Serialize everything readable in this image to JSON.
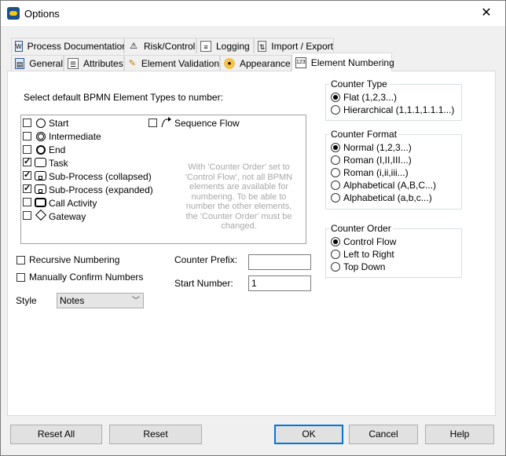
{
  "window": {
    "title": "Options",
    "close_glyph": "✕"
  },
  "tabs_row1": [
    {
      "label": "Process Documentation",
      "icon": "document-icon"
    },
    {
      "label": "Risk/Control",
      "icon": "warning-icon"
    },
    {
      "label": "Logging",
      "icon": "log-icon"
    },
    {
      "label": "Import / Export",
      "icon": "import-export-icon"
    }
  ],
  "tabs_row2": [
    {
      "label": "General",
      "icon": "general-icon"
    },
    {
      "label": "Attributes",
      "icon": "attributes-icon"
    },
    {
      "label": "Element Validation",
      "icon": "validation-icon"
    },
    {
      "label": "Appearance",
      "icon": "palette-icon"
    },
    {
      "label": "Element Numbering",
      "icon": "numbering-icon",
      "active": true
    }
  ],
  "element_types": {
    "heading": "Select default BPMN Element Types to number:",
    "items": [
      {
        "label": "Start",
        "checked": false
      },
      {
        "label": "Intermediate",
        "checked": false
      },
      {
        "label": "End",
        "checked": false
      },
      {
        "label": "Task",
        "checked": true
      },
      {
        "label": "Sub-Process (collapsed)",
        "checked": true
      },
      {
        "label": "Sub-Process (expanded)",
        "checked": true
      },
      {
        "label": "Call Activity",
        "checked": false
      },
      {
        "label": "Gateway",
        "checked": false
      },
      {
        "label": "Sequence Flow",
        "checked": false
      }
    ],
    "hint": "With 'Counter Order' set to 'Control Flow', not all BPMN elements are available for numbering. To be able to number the other elements, the 'Counter Order' must be changed."
  },
  "options": {
    "recursive_numbering": {
      "label": "Recursive Numbering",
      "checked": false
    },
    "manually_confirm": {
      "label": "Manually Confirm Numbers",
      "checked": false
    },
    "style": {
      "label": "Style",
      "value": "Notes"
    },
    "counter_prefix": {
      "label": "Counter Prefix:",
      "value": ""
    },
    "start_number": {
      "label": "Start Number:",
      "value": "1"
    }
  },
  "counter_type": {
    "legend": "Counter Type",
    "options": [
      {
        "label": "Flat (1,2,3...)",
        "selected": true
      },
      {
        "label": "Hierarchical (1,1.1,1.1.1...)",
        "selected": false
      }
    ]
  },
  "counter_format": {
    "legend": "Counter Format",
    "options": [
      {
        "label": "Normal (1,2,3...)",
        "selected": true
      },
      {
        "label": "Roman (I,II,III...)",
        "selected": false
      },
      {
        "label": "Roman (i,ii,iii...)",
        "selected": false
      },
      {
        "label": "Alphabetical (A,B,C...)",
        "selected": false
      },
      {
        "label": "Alphabetical (a,b,c...)",
        "selected": false
      }
    ]
  },
  "counter_order": {
    "legend": "Counter Order",
    "options": [
      {
        "label": "Control Flow",
        "selected": true
      },
      {
        "label": "Left to Right",
        "selected": false
      },
      {
        "label": "Top Down",
        "selected": false
      }
    ]
  },
  "buttons": {
    "reset_all": "Reset All",
    "reset": "Reset",
    "ok": "OK",
    "cancel": "Cancel",
    "help": "Help"
  }
}
